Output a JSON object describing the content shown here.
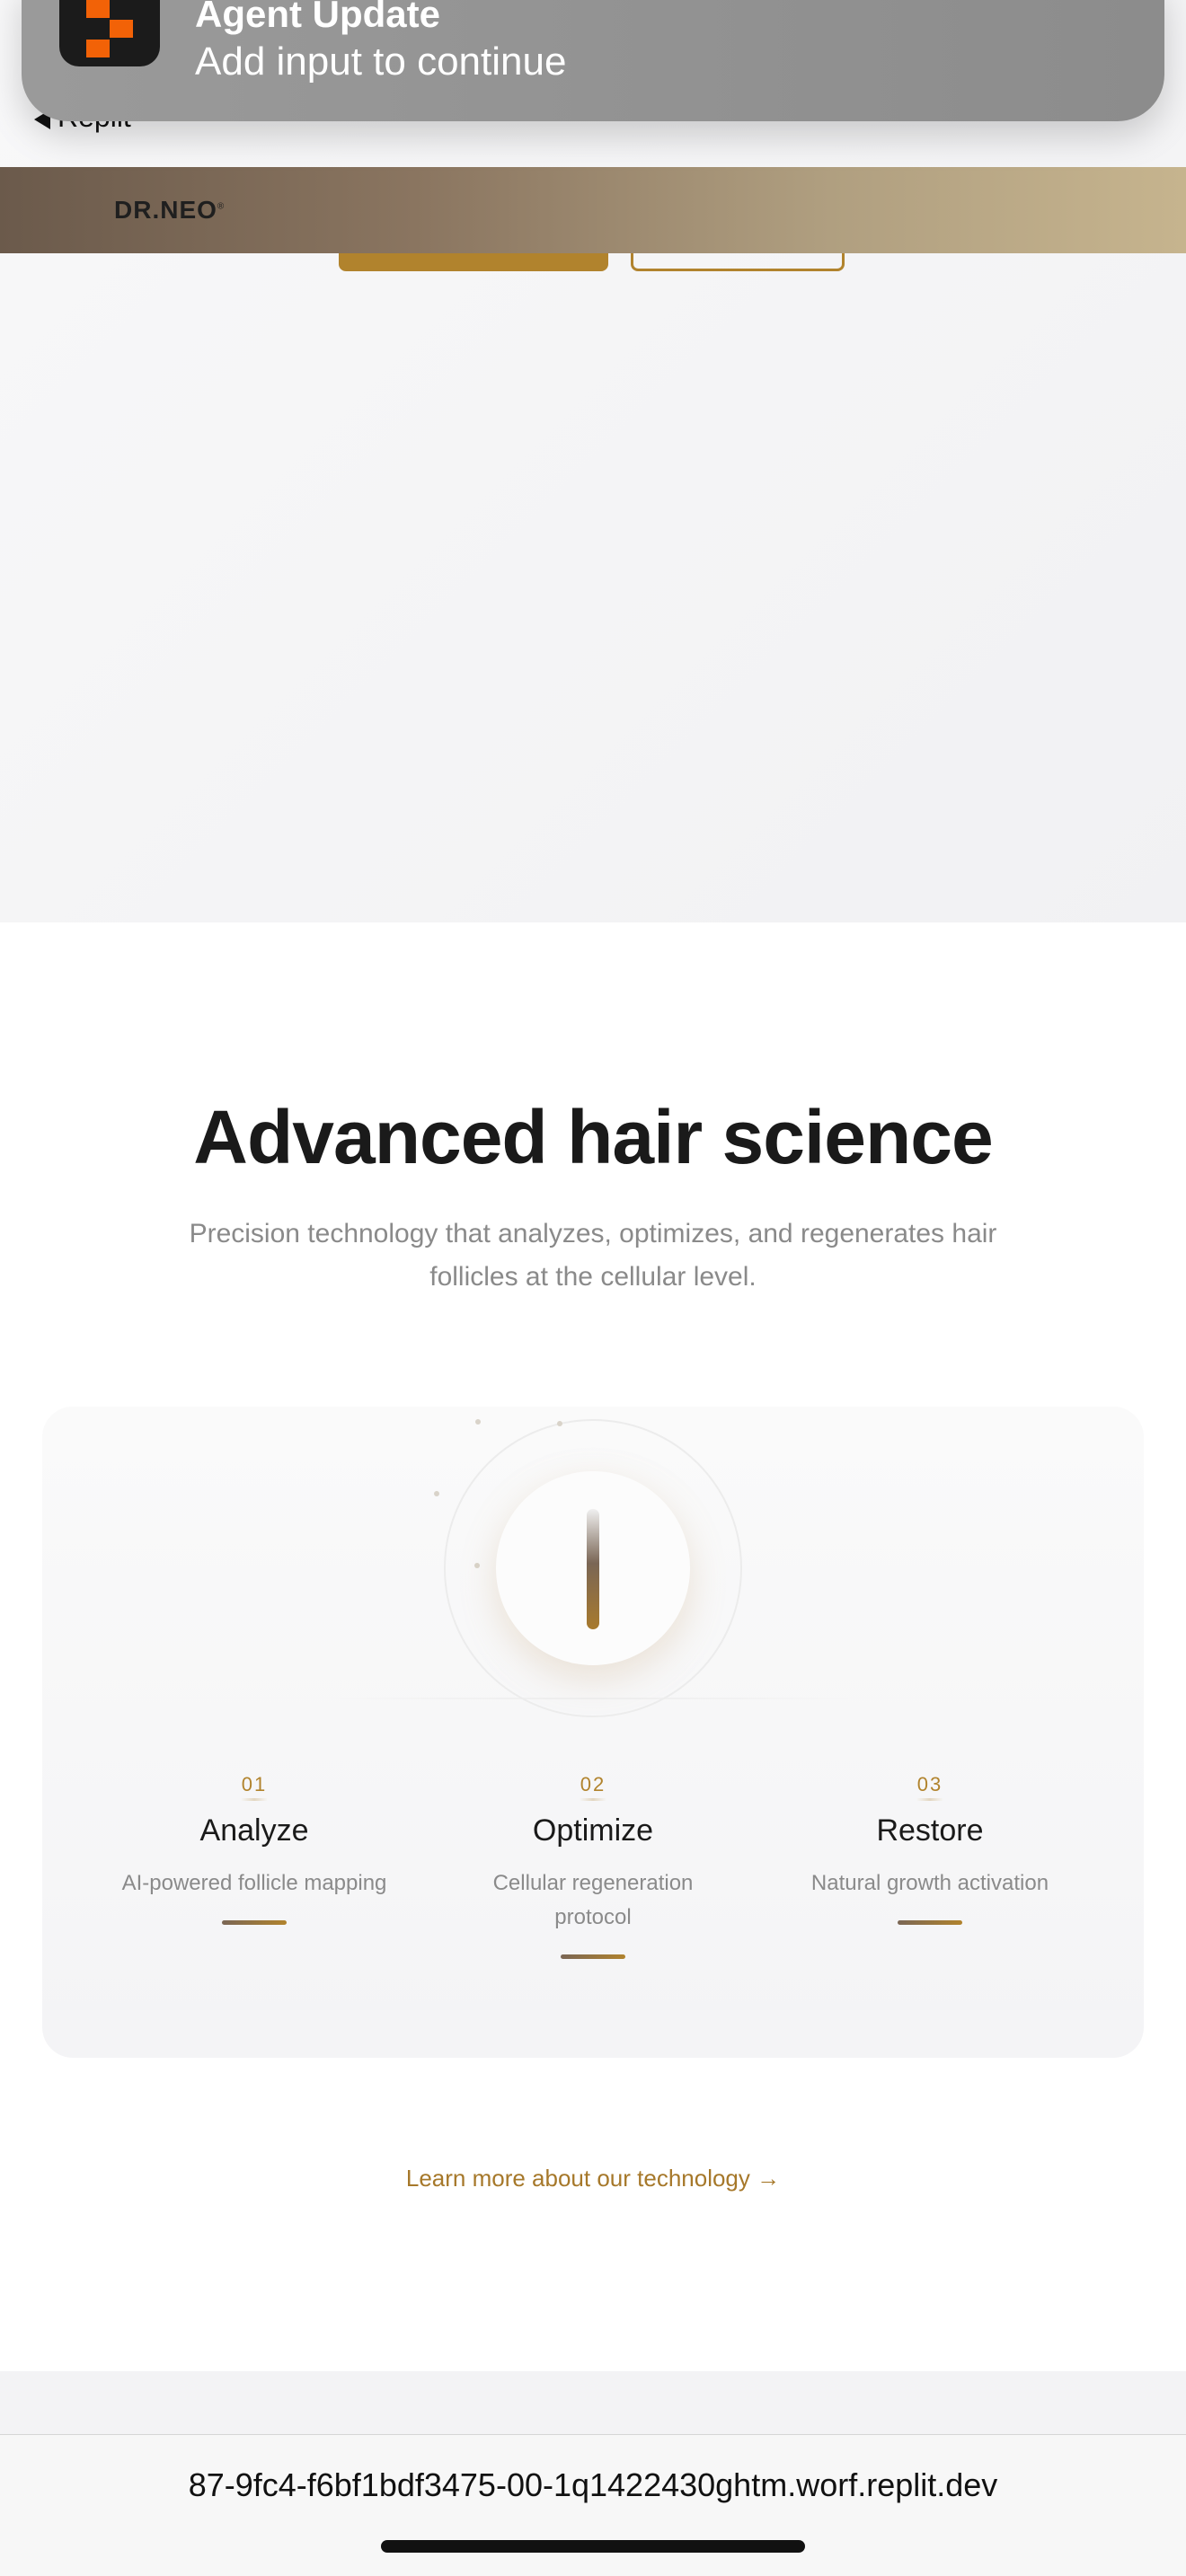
{
  "notification": {
    "title": "Agent Update",
    "body": "Add input to continue",
    "app_icon": "replit-icon"
  },
  "status_bar": {
    "back_label": "Replit"
  },
  "header": {
    "brand": "DR.NEO",
    "brand_mark": "®"
  },
  "section": {
    "title": "Advanced hair science",
    "subtitle": "Precision technology that analyzes, optimizes, and regenerates hair follicles at the cellular level."
  },
  "steps": [
    {
      "num": "01",
      "title": "Analyze",
      "desc": "AI-powered follicle mapping"
    },
    {
      "num": "02",
      "title": "Optimize",
      "desc": "Cellular regeneration protocol"
    },
    {
      "num": "03",
      "title": "Restore",
      "desc": "Natural growth activation"
    }
  ],
  "learn_more": "Learn more about our technology →",
  "browser": {
    "url": "87-9fc4-f6bf1bdf3475-00-1q1422430ghtm.worf.replit.dev"
  },
  "colors": {
    "accent_gold": "#b1832d",
    "notification_bg": "#8c8c8c",
    "text_dark": "#1a1a1a",
    "text_muted": "#8a8a8a"
  }
}
